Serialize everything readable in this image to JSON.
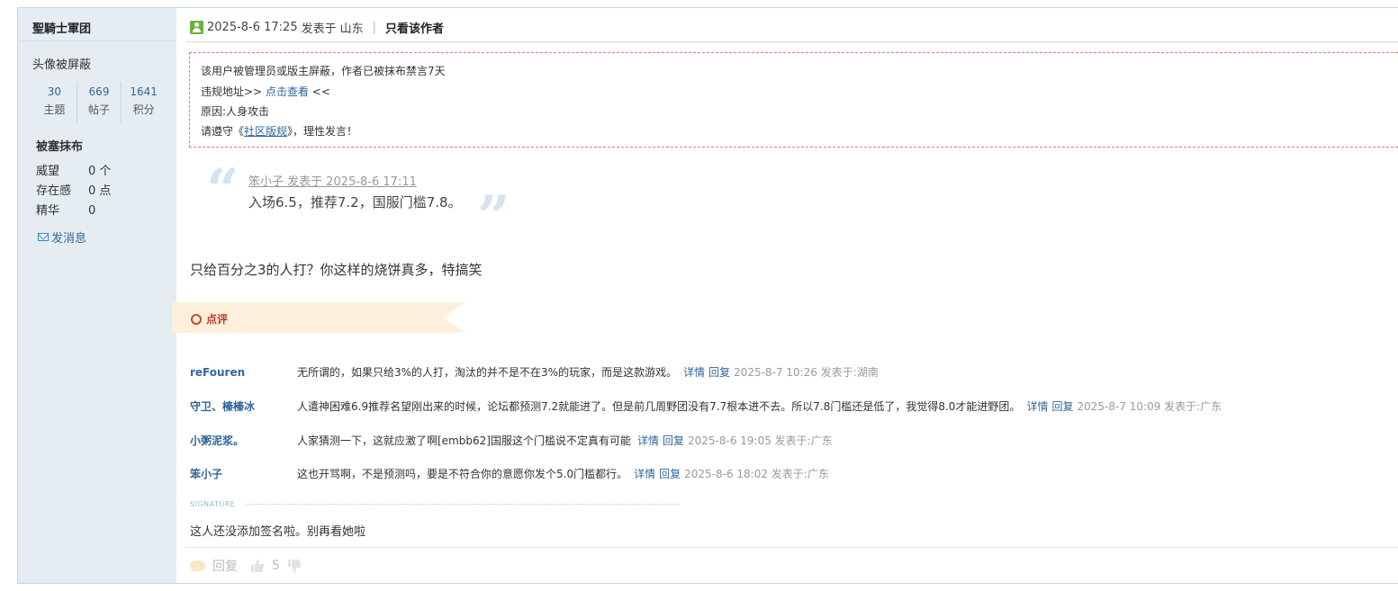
{
  "sidebar": {
    "username": "聖騎士軍团",
    "avatar_hidden": "头像被屏蔽",
    "stats": [
      {
        "num": "30",
        "label": "主题"
      },
      {
        "num": "669",
        "label": "帖子"
      },
      {
        "num": "1641",
        "label": "积分"
      }
    ],
    "group": "被塞抹布",
    "attrs": [
      {
        "key": "威望",
        "value": "0 个"
      },
      {
        "key": "存在感",
        "value": "0 点"
      },
      {
        "key": "精华",
        "value": "0"
      }
    ],
    "send_message": "发消息"
  },
  "post": {
    "datetime": "2025-8-6 17:25",
    "posted_at": "发表于",
    "location": "山东",
    "separator": "|",
    "only_author": "只看该作者"
  },
  "notice": {
    "line1": "该用户被管理员或版主屏蔽，作者已被抹布禁言7天",
    "line2_prefix": "违规地址>> ",
    "line2_link": "点击查看",
    "line2_suffix": " <<",
    "line3": "原因:人身攻击",
    "line4_prefix": "请遵守《",
    "line4_link": "社区版规",
    "line4_suffix": "》，理性发言！"
  },
  "quote": {
    "author_line": "笨小子 发表于 2025-8-6 17:11",
    "text": "入场6.5，推荐7.2，国服门槛7.8。",
    "open_mark": "“",
    "close_mark": "”"
  },
  "body_text": "只给百分之3的人打？你这样的烧饼真多，特搞笑",
  "rating": {
    "label": "点评"
  },
  "comments": [
    {
      "name": "reFouren",
      "text": "无所谓的，如果只给3%的人打，淘汰的并不是不在3%的玩家，而是这款游戏。",
      "detail": "详情",
      "reply": "回复",
      "time": "2025-8-7 10:26 发表于:湖南"
    },
    {
      "name": "守卫、榛榛冰",
      "text": "人遣神困难6.9推荐名望刚出来的时候，论坛都预测7.2就能进了。但是前几周野团没有7.7根本进不去。所以7.8门槛还是低了，我觉得8.0才能进野团。",
      "detail": "详情",
      "reply": "回复",
      "time": "2025-8-7 10:09 发表于:广东"
    },
    {
      "name": "小粥泥浆。",
      "text": "人家猜测一下，这就应激了啊[embb62]国服这个门槛说不定真有可能",
      "detail": "详情",
      "reply": "回复",
      "time": "2025-8-6 19:05 发表于:广东"
    },
    {
      "name": "笨小子",
      "text": "这也开骂啊，不是预测吗，要是不符合你的意愿你发个5.0门槛都行。",
      "detail": "详情",
      "reply": "回复",
      "time": "2025-8-6 18:02 发表于:广东"
    }
  ],
  "signature": {
    "label": "SIGNATURE",
    "text": "这人还没添加签名啦。别再看她啦"
  },
  "footer": {
    "reply": "回复",
    "likes": "5"
  },
  "colors": {
    "link": "#336699",
    "sidebar_bg": "#e5edf2",
    "notice_border": "#e0787a",
    "ribbon_bg": "#fcf0dc",
    "rating_red": "#c0392b"
  }
}
